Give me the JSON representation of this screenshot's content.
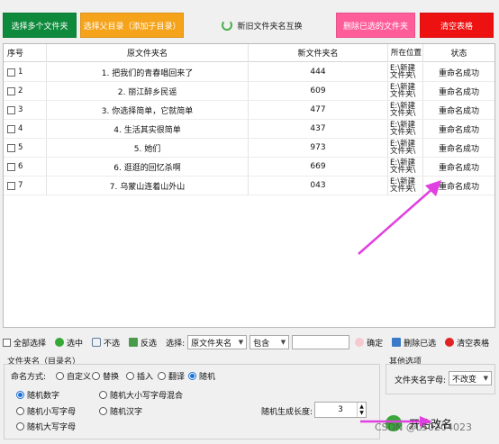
{
  "top_buttons": {
    "select_multiple": "选择多个文件夹",
    "select_parent": "选择父目录（添加子目录）",
    "swap_names": "新旧文件夹名互换",
    "delete_selected": "删除已选的文件夹",
    "clear_table": "清空表格"
  },
  "table": {
    "headers": [
      "序号",
      "原文件夹名",
      "新文件夹名",
      "所在位置",
      "状态"
    ],
    "rows": [
      {
        "num": "1",
        "old": "1. 把我们的青春唱回来了",
        "new": "444",
        "loc1": "E:\\新建",
        "loc2": "文件夹\\",
        "status": "重命名成功"
      },
      {
        "num": "2",
        "old": "2. 丽江醉乡民谣",
        "new": "609",
        "loc1": "E:\\新建",
        "loc2": "文件夹\\",
        "status": "重命名成功"
      },
      {
        "num": "3",
        "old": "3. 你选择简单，它就简单",
        "new": "477",
        "loc1": "E:\\新建",
        "loc2": "文件夹\\",
        "status": "重命名成功"
      },
      {
        "num": "4",
        "old": "4. 生活其实很简单",
        "new": "437",
        "loc1": "E:\\新建",
        "loc2": "文件夹\\",
        "status": "重命名成功"
      },
      {
        "num": "5",
        "old": "5. 她们",
        "new": "973",
        "loc1": "E:\\新建",
        "loc2": "文件夹\\",
        "status": "重命名成功"
      },
      {
        "num": "6",
        "old": "6. 逛逛的回忆杀啊",
        "new": "669",
        "loc1": "E:\\新建",
        "loc2": "文件夹\\",
        "status": "重命名成功"
      },
      {
        "num": "7",
        "old": "7. 乌蒙山连着山外山",
        "new": "043",
        "loc1": "E:\\新建",
        "loc2": "文件夹\\",
        "status": "重命名成功"
      }
    ]
  },
  "toolbar": {
    "select_all": "全部选择",
    "check": "选中",
    "uncheck": "不选",
    "invert": "反选",
    "choose_label": "选择:",
    "field_select": "原文件夹名",
    "match_select": "包含",
    "search_value": "",
    "confirm": "确定",
    "delete_selected": "删除已选",
    "clear_table": "清空表格"
  },
  "naming": {
    "section_title": "文件夹名（目录名）",
    "mode_label": "命名方式:",
    "modes": [
      "自定义",
      "替换",
      "插入",
      "翻译",
      "随机"
    ],
    "selected_mode": "随机",
    "random_options": [
      "随机数字",
      "随机大小写字母混合",
      "随机小写字母",
      "随机汉字",
      "随机大写字母"
    ],
    "selected_random": "随机数字",
    "length_label": "随机生成长度:",
    "length_value": "3"
  },
  "other": {
    "section_title": "其他选项",
    "case_label": "文件夹名字母:",
    "case_value": "不改变"
  },
  "start_button": "开始改名",
  "watermark": "CSDN @L50204023",
  "colors": {
    "select_multiple": "#0f8a3c",
    "select_parent": "#f5a31a",
    "delete_selected": "#ff5c9a",
    "clear_table": "#ee1111",
    "arrow": "#e040e0",
    "radio_selected": "#1d6fd6"
  }
}
